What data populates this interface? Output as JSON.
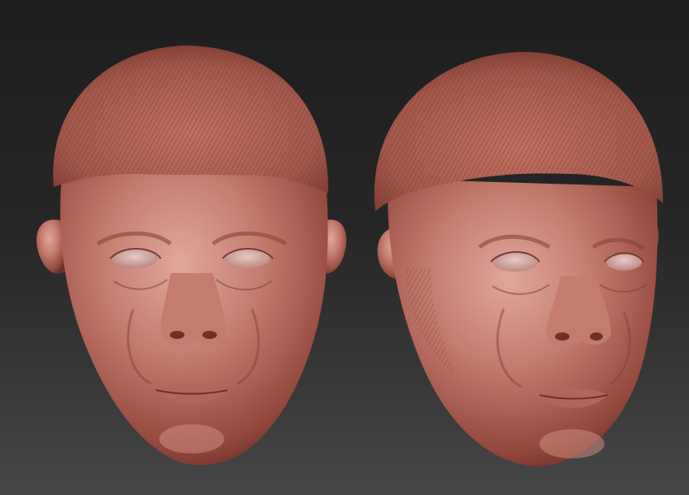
{
  "scene": {
    "background_top": "#1e1e1e",
    "background_bottom": "#474747",
    "material_color": "#b86a5c",
    "material_highlight": "#e0a89a",
    "material_shadow": "#6e3028"
  },
  "models": [
    {
      "name": "front-view-head-sculpt",
      "view": "front"
    },
    {
      "name": "three-quarter-view-head-sculpt",
      "view": "three-quarter"
    }
  ]
}
